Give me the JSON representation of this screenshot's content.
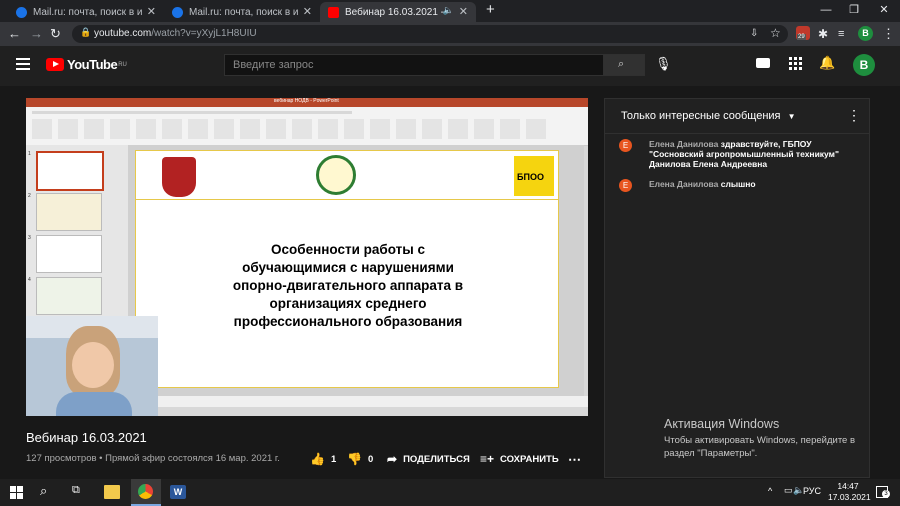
{
  "browser": {
    "tabs": [
      {
        "title": "Mail.ru: почта, поиск в интерне",
        "active": false
      },
      {
        "title": "Mail.ru: почта, поиск в интерне",
        "active": false
      },
      {
        "title": "Вебинар 16.03.2021 - YouTu",
        "active": true
      }
    ],
    "url_host": "youtube.com",
    "url_path": "/watch?v=yXyjL1H8UIU",
    "profile_initial": "B",
    "extension_badge": "29"
  },
  "youtube": {
    "logo_text": "YouTube",
    "logo_region": "RU",
    "search_placeholder": "Введите запрос",
    "avatar_initial": "B"
  },
  "slide": {
    "ppt_title": "вебинар НОДВ - PowerPoint",
    "title_lines": [
      "Особенности работы с",
      "обучающимися с нарушениями",
      "опорно-двигательного аппарата в",
      "организациях среднего",
      "профессионального образования"
    ],
    "logo_right": "БПОО",
    "slide_numbers": [
      "1",
      "2",
      "3",
      "4"
    ]
  },
  "video": {
    "title": "Вебинар 16.03.2021",
    "meta": "127 просмотров • Прямой эфир состоялся 16 мар. 2021 г.",
    "likes": "1",
    "dislikes": "0",
    "share_label": "ПОДЕЛИТЬСЯ",
    "save_label": "СОХРАНИТЬ"
  },
  "chat": {
    "mode_label": "Только интересные сообщения",
    "messages": [
      {
        "avatar": "Е",
        "author": "Елена Данилова",
        "text": "здравствуйте, ГБПОУ \"Сосновский агропромышленный техникум\" Данилова Елена Андреевна"
      },
      {
        "avatar": "Е",
        "author": "Елена Данилова",
        "text": "слышно"
      }
    ]
  },
  "activation": {
    "title": "Активация Windows",
    "line1": "Чтобы активировать Windows, перейдите в",
    "line2": "раздел \"Параметры\"."
  },
  "taskbar": {
    "language": "РУС",
    "time": "14:47",
    "date": "17.03.2021",
    "notification_count": "3"
  },
  "colors": {
    "youtube_red": "#ff0000",
    "chat_avatar": "#e8551f",
    "profile_green": "#1e8e3e"
  }
}
